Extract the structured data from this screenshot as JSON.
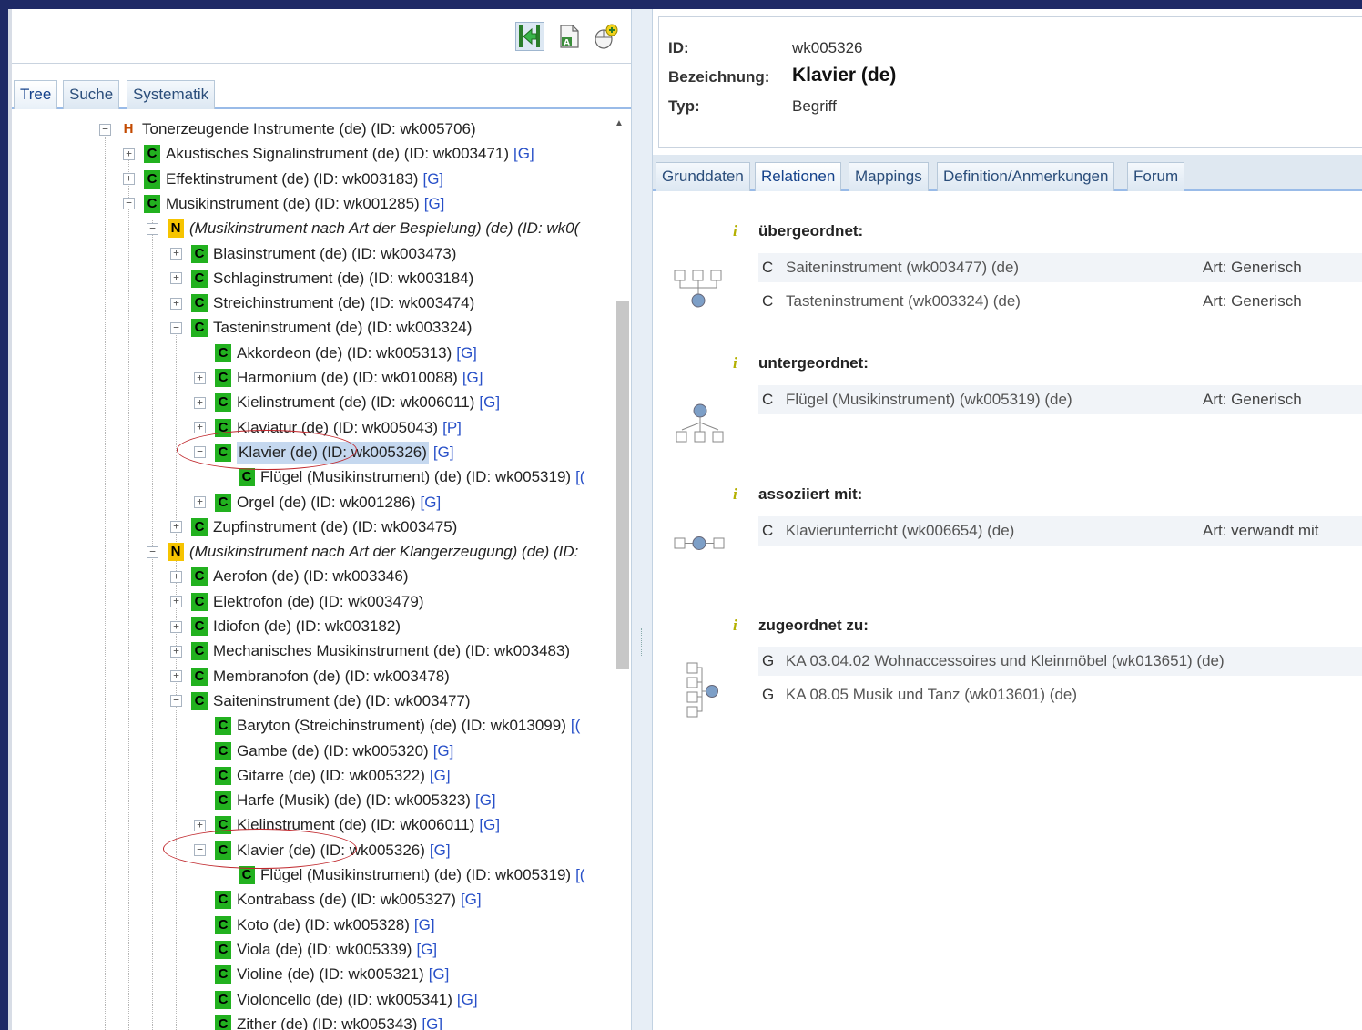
{
  "left": {
    "toolbar": {
      "icons": [
        "back-to-tree-icon",
        "document-a-icon",
        "mouse-add-icon"
      ]
    },
    "tabs": [
      {
        "label": "Tree",
        "active": true
      },
      {
        "label": "Suche",
        "active": false
      },
      {
        "label": "Systematik",
        "active": false
      }
    ],
    "tree": [
      {
        "level": 0,
        "exp": "-",
        "badge": "H",
        "label": "Tonerzeugende Instrumente (de) (ID: wk005706)",
        "link": ""
      },
      {
        "level": 1,
        "exp": "+",
        "badge": "C",
        "label": "Akustisches Signalinstrument (de) (ID: wk003471)",
        "link": "[G]"
      },
      {
        "level": 1,
        "exp": "+",
        "badge": "C",
        "label": "Effektinstrument (de) (ID: wk003183)",
        "link": "[G]"
      },
      {
        "level": 1,
        "exp": "-",
        "badge": "C",
        "label": "Musikinstrument (de) (ID: wk001285)",
        "link": "[G]"
      },
      {
        "level": 2,
        "exp": "-",
        "badge": "N",
        "label": "(Musikinstrument nach Art der Bespielung) (de) (ID: wk0(",
        "link": "",
        "italic": true
      },
      {
        "level": 3,
        "exp": "+",
        "badge": "C",
        "label": "Blasinstrument (de) (ID: wk003473)",
        "link": ""
      },
      {
        "level": 3,
        "exp": "+",
        "badge": "C",
        "label": "Schlaginstrument (de) (ID: wk003184)",
        "link": ""
      },
      {
        "level": 3,
        "exp": "+",
        "badge": "C",
        "label": "Streichinstrument (de) (ID: wk003474)",
        "link": ""
      },
      {
        "level": 3,
        "exp": "-",
        "badge": "C",
        "label": "Tasteninstrument (de) (ID: wk003324)",
        "link": ""
      },
      {
        "level": 4,
        "exp": "",
        "badge": "C",
        "label": "Akkordeon (de) (ID: wk005313)",
        "link": "[G]"
      },
      {
        "level": 4,
        "exp": "+",
        "badge": "C",
        "label": "Harmonium (de) (ID: wk010088)",
        "link": "[G]"
      },
      {
        "level": 4,
        "exp": "+",
        "badge": "C",
        "label": "Kielinstrument (de) (ID: wk006011)",
        "link": "[G]"
      },
      {
        "level": 4,
        "exp": "+",
        "badge": "C",
        "label": "Klaviatur (de) (ID: wk005043)",
        "link": "[P]"
      },
      {
        "level": 4,
        "exp": "-",
        "badge": "C",
        "label": "Klavier (de) (ID: wk005326)",
        "link": "[G]",
        "selected": true
      },
      {
        "level": 5,
        "exp": "",
        "badge": "C",
        "label": "Flügel (Musikinstrument) (de) (ID: wk005319)",
        "link": "[("
      },
      {
        "level": 4,
        "exp": "+",
        "badge": "C",
        "label": "Orgel (de) (ID: wk001286)",
        "link": "[G]"
      },
      {
        "level": 3,
        "exp": "+",
        "badge": "C",
        "label": "Zupfinstrument (de) (ID: wk003475)",
        "link": ""
      },
      {
        "level": 2,
        "exp": "-",
        "badge": "N",
        "label": "(Musikinstrument nach Art der Klangerzeugung) (de) (ID:",
        "link": "",
        "italic": true
      },
      {
        "level": 3,
        "exp": "+",
        "badge": "C",
        "label": "Aerofon (de) (ID: wk003346)",
        "link": ""
      },
      {
        "level": 3,
        "exp": "+",
        "badge": "C",
        "label": "Elektrofon (de) (ID: wk003479)",
        "link": ""
      },
      {
        "level": 3,
        "exp": "+",
        "badge": "C",
        "label": "Idiofon (de) (ID: wk003182)",
        "link": ""
      },
      {
        "level": 3,
        "exp": "+",
        "badge": "C",
        "label": "Mechanisches Musikinstrument (de) (ID: wk003483)",
        "link": ""
      },
      {
        "level": 3,
        "exp": "+",
        "badge": "C",
        "label": "Membranofon (de) (ID: wk003478)",
        "link": ""
      },
      {
        "level": 3,
        "exp": "-",
        "badge": "C",
        "label": "Saiteninstrument (de) (ID: wk003477)",
        "link": ""
      },
      {
        "level": 4,
        "exp": "",
        "badge": "C",
        "label": "Baryton (Streichinstrument) (de) (ID: wk013099)",
        "link": "[("
      },
      {
        "level": 4,
        "exp": "",
        "badge": "C",
        "label": "Gambe (de) (ID: wk005320)",
        "link": "[G]"
      },
      {
        "level": 4,
        "exp": "",
        "badge": "C",
        "label": "Gitarre (de) (ID: wk005322)",
        "link": "[G]"
      },
      {
        "level": 4,
        "exp": "",
        "badge": "C",
        "label": "Harfe (Musik) (de) (ID: wk005323)",
        "link": "[G]"
      },
      {
        "level": 4,
        "exp": "+",
        "badge": "C",
        "label": "Kielinstrument (de) (ID: wk006011)",
        "link": "[G]"
      },
      {
        "level": 4,
        "exp": "-",
        "badge": "C",
        "label": "Klavier (de) (ID: wk005326)",
        "link": "[G]"
      },
      {
        "level": 5,
        "exp": "",
        "badge": "C",
        "label": "Flügel (Musikinstrument) (de) (ID: wk005319)",
        "link": "[("
      },
      {
        "level": 4,
        "exp": "",
        "badge": "C",
        "label": "Kontrabass (de) (ID: wk005327)",
        "link": "[G]"
      },
      {
        "level": 4,
        "exp": "",
        "badge": "C",
        "label": "Koto (de) (ID: wk005328)",
        "link": "[G]"
      },
      {
        "level": 4,
        "exp": "",
        "badge": "C",
        "label": "Viola (de) (ID: wk005339)",
        "link": "[G]"
      },
      {
        "level": 4,
        "exp": "",
        "badge": "C",
        "label": "Violine (de) (ID: wk005321)",
        "link": "[G]"
      },
      {
        "level": 4,
        "exp": "",
        "badge": "C",
        "label": "Violoncello (de) (ID: wk005341)",
        "link": "[G]"
      },
      {
        "level": 4,
        "exp": "",
        "badge": "C",
        "label": "Zither (de) (ID: wk005343)",
        "link": "[G]"
      }
    ]
  },
  "right": {
    "info": {
      "id_label": "ID:",
      "id_value": "wk005326",
      "name_label": "Bezeichnung:",
      "name_value": "Klavier (de)",
      "type_label": "Typ:",
      "type_value": "Begriff"
    },
    "tabs": [
      {
        "label": "Grunddaten",
        "active": false
      },
      {
        "label": "Relationen",
        "active": true
      },
      {
        "label": "Mappings",
        "active": false
      },
      {
        "label": "Definition/Anmerkungen",
        "active": false
      },
      {
        "label": "Forum",
        "active": false
      }
    ],
    "sections": [
      {
        "info_icon": "i",
        "title": "übergeordnet:",
        "diagram": "parent-hierarchy-icon",
        "rows": [
          {
            "type": "C",
            "name": "Saiteninstrument (wk003477) (de)",
            "art": "Art: Generisch"
          },
          {
            "type": "C",
            "name": "Tasteninstrument (wk003324) (de)",
            "art": "Art: Generisch"
          }
        ]
      },
      {
        "info_icon": "i",
        "title": "untergeordnet:",
        "diagram": "child-hierarchy-icon",
        "rows": [
          {
            "type": "C",
            "name": "Flügel (Musikinstrument) (wk005319) (de)",
            "art": "Art: Generisch"
          }
        ]
      },
      {
        "info_icon": "i",
        "title": "assoziiert mit:",
        "diagram": "association-icon",
        "rows": [
          {
            "type": "C",
            "name": "Klavierunterricht (wk006654) (de)",
            "art": "Art: verwandt mit"
          }
        ]
      },
      {
        "info_icon": "i",
        "title": "zugeordnet zu:",
        "diagram": "assignment-icon",
        "rows": [
          {
            "type": "G",
            "name": "KA 03.04.02 Wohnaccessoires und Kleinmöbel (wk013651) (de)",
            "art": ""
          },
          {
            "type": "G",
            "name": "KA 08.05 Musik und Tanz (wk013601) (de)",
            "art": ""
          }
        ]
      }
    ]
  },
  "colors": {
    "frame": "#1f2a66",
    "badge_c": "#22b11f",
    "badge_n": "#f6c400",
    "link": "#2850c8",
    "tab_border": "#99bbe8",
    "annotation": "#c0282d"
  }
}
